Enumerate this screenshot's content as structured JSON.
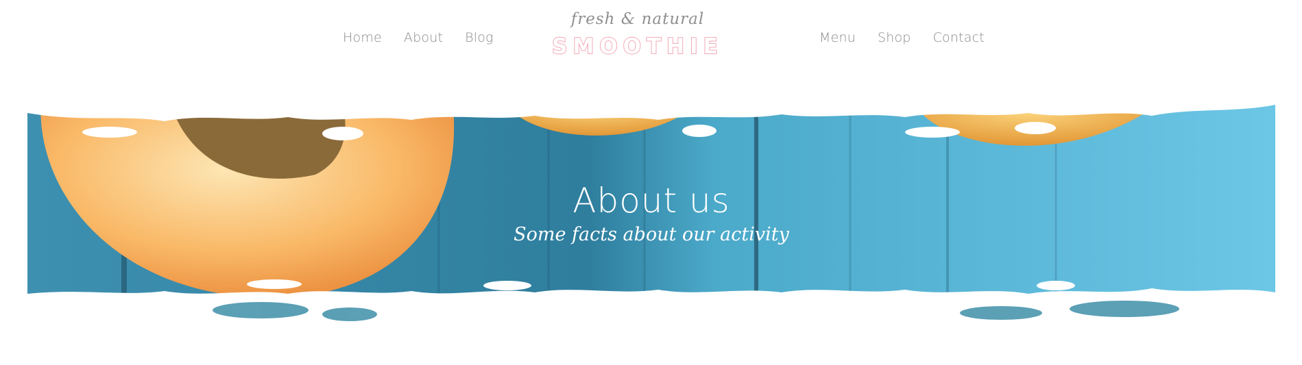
{
  "nav_left": [
    {
      "label": "Home"
    },
    {
      "label": "About"
    },
    {
      "label": "Blog"
    }
  ],
  "nav_right": [
    {
      "label": "Menu"
    },
    {
      "label": "Shop"
    },
    {
      "label": "Contact"
    }
  ],
  "logo": {
    "tagline": "fresh & natural",
    "name": "SMOOTHIE",
    "accent_color": "#f2a9b6"
  },
  "hero": {
    "title": "About us",
    "subtitle": "Some facts about our activity",
    "image": "apricot-slices-on-blue-wooden-planks",
    "colors": {
      "wood": "#4ba9c9",
      "fruit": "#f6a649"
    }
  }
}
